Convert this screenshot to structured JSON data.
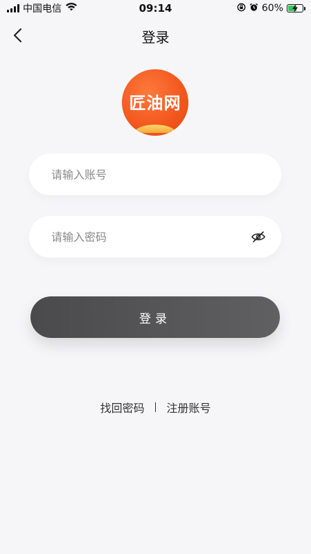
{
  "status_bar": {
    "carrier": "中国电信",
    "time": "09:14",
    "battery_percent": "60%",
    "battery_level": 0.6,
    "icons": [
      "signal-icon",
      "wifi-icon",
      "rotation-lock-icon",
      "alarm-icon",
      "battery-charging-icon"
    ]
  },
  "nav": {
    "title": "登录",
    "back_icon": "chevron-left-icon"
  },
  "logo": {
    "text": "匠油网",
    "colors": {
      "primary": "#f2561d",
      "accent": "#f2a83a"
    }
  },
  "form": {
    "account_placeholder": "请输入账号",
    "account_value": "",
    "password_placeholder": "请输入密码",
    "password_value": "",
    "password_toggle_icon": "eye-off-icon"
  },
  "login_button": {
    "label": "登录",
    "color": "#4e4e50"
  },
  "links": {
    "recover": "找回密码",
    "register": "注册账号"
  }
}
